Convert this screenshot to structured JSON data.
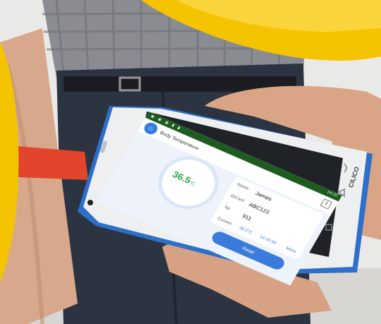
{
  "status_bar": {
    "time": "14:20"
  },
  "app": {
    "title": "Body Temperature"
  },
  "reading": {
    "value": "36.5",
    "unit": "°C"
  },
  "patient": {
    "name_label": "Name:",
    "name_value": "James",
    "idcard_label": "IDCard",
    "idcard_value": "ABC123",
    "tel_label": "Tel",
    "tel_value": "911"
  },
  "history": {
    "label": "Current",
    "temp": "36.5°C",
    "time": "14:20:30",
    "more_label": "More"
  },
  "read_button": {
    "label": "Read"
  },
  "device": {
    "brand": "CILICO"
  },
  "colors": {
    "accent_blue": "#3a7bdc",
    "reading_green": "#2aa34a",
    "banner_yellow": "#f5c400",
    "device_blue": "#2d6fc9"
  }
}
